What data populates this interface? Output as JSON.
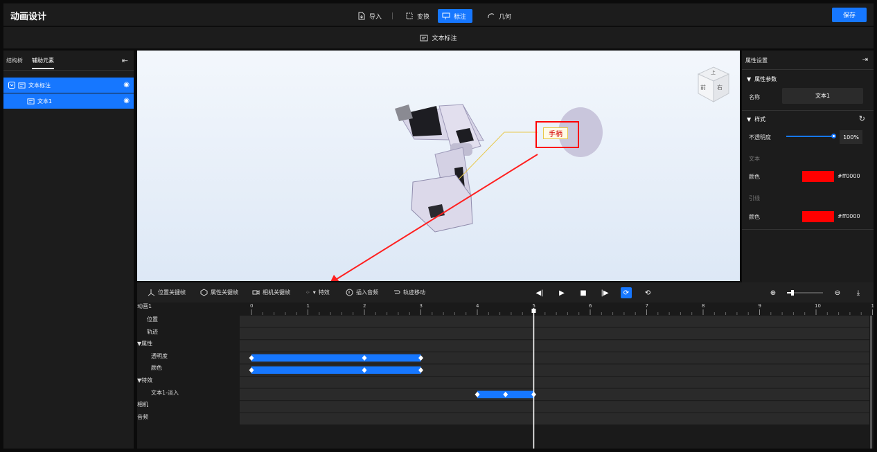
{
  "app": {
    "title": "动画设计",
    "save_label": "保存"
  },
  "toolbar": {
    "import": "导入",
    "transform": "变换",
    "annotate": "标注",
    "geometry": "几何"
  },
  "subbar": {
    "label": "文本标注"
  },
  "left": {
    "tabs": [
      "结构树",
      "辅助元素"
    ],
    "tree": [
      {
        "label": "文本标注"
      },
      {
        "label": "文本1"
      }
    ]
  },
  "viewport": {
    "annotation_text": "手柄",
    "cube_faces": [
      "前",
      "右",
      "上"
    ]
  },
  "props": {
    "title": "属性设置",
    "section_params": "属性参数",
    "name_label": "名称",
    "name_value": "文本1",
    "section_style": "样式",
    "opacity_label": "不透明度",
    "opacity_value": "100%",
    "opacity_fraction": 1.0,
    "text_group": "文本",
    "text_color_label": "颜色",
    "text_color_value": "#ff0000",
    "leader_group": "引线",
    "leader_color_label": "颜色",
    "leader_color_value": "#ff0000"
  },
  "timeline": {
    "tools": {
      "pos_kf": "位置关键帧",
      "attr_kf": "属性关键帧",
      "cam_kf": "相机关键帧",
      "effects": "特效",
      "audio": "插入音频",
      "track_move": "轨迹移动"
    },
    "anim_name": "动画1",
    "ruler": [
      "0",
      "1",
      "2",
      "3",
      "4",
      "5",
      "6",
      "7",
      "8",
      "9",
      "10",
      "1"
    ],
    "playhead": 5,
    "tracks": [
      {
        "label": "位置",
        "indent": 1
      },
      {
        "label": "轨迹",
        "indent": 1
      },
      {
        "label": "▼属性",
        "indent": 0
      },
      {
        "label": "透明度",
        "indent": 2,
        "clip": [
          0,
          3
        ],
        "keys": [
          0,
          2,
          3
        ]
      },
      {
        "label": "颜色",
        "indent": 2,
        "clip": [
          0,
          3
        ],
        "keys": [
          0,
          2,
          3
        ]
      },
      {
        "label": "▼特效",
        "indent": 0
      },
      {
        "label": "文本1-淡入",
        "indent": 2,
        "clip": [
          4,
          5
        ],
        "keys": [
          4,
          4.5,
          5
        ]
      },
      {
        "label": "相机",
        "indent": 0
      },
      {
        "label": "音频",
        "indent": 0
      }
    ]
  },
  "colors": {
    "accent": "#1677ff",
    "annotation_red": "#ff0000"
  }
}
